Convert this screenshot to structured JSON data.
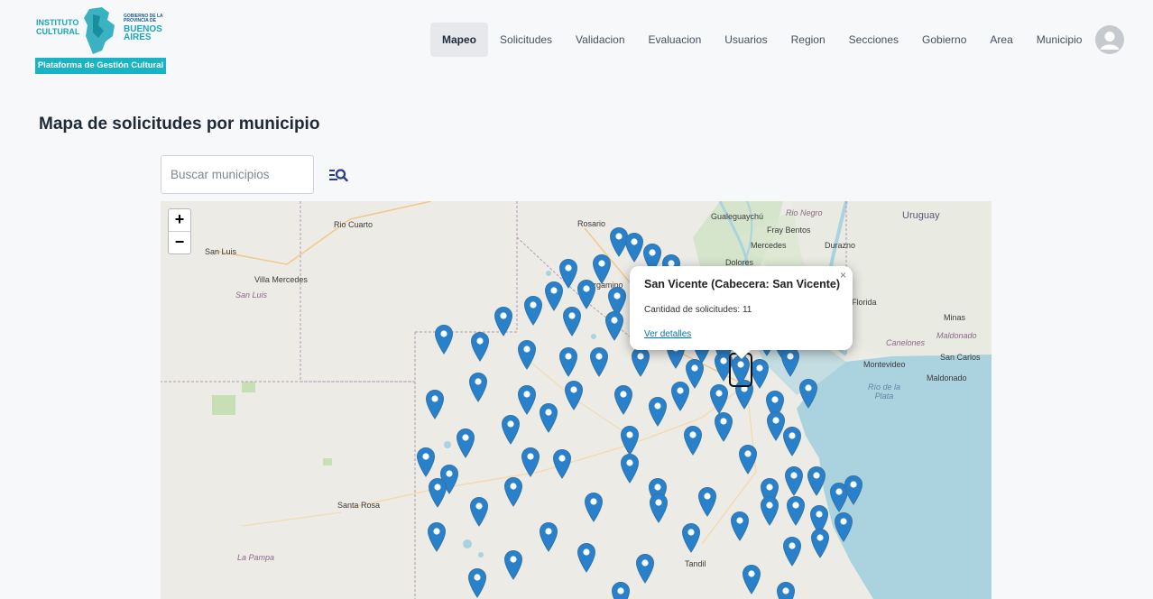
{
  "brand": {
    "ic_line1": "INSTITUTO",
    "ic_line2": "CULTURAL",
    "gob_text": "GOBIERNO DE LA PROVINCIA DE",
    "ba_line1": "BUENOS",
    "ba_line2": "AIRES",
    "platform": "Plataforma de Gestión Cultural"
  },
  "nav": [
    "Mapeo",
    "Solicitudes",
    "Validacion",
    "Evaluacion",
    "Usuarios",
    "Region",
    "Secciones",
    "Gobierno",
    "Area",
    "Municipio"
  ],
  "nav_active": "Mapeo",
  "page_title": "Mapa de solicitudes por municipio",
  "search": {
    "placeholder": "Buscar municipios",
    "value": ""
  },
  "map": {
    "zoom_in": "+",
    "zoom_out": "−",
    "labels": {
      "rio_cuarto": "Rio Cuarto",
      "rosario": "Rosario",
      "gualeguaychu": "Gualeguaychú",
      "rio_negro": "Rio Negro",
      "uruguay": "Uruguay",
      "fray_bentos": "Fray Bentos",
      "mercedes": "Mercedes",
      "durazno": "Durazno",
      "dolores": "Dolores",
      "san_luis_city": "San Luis",
      "villa_mercedes": "Villa Mercedes",
      "san_luis_prov": "San Luis",
      "pergamino": "Pergamino",
      "florida": "Florida",
      "canelones": "Canelones",
      "minas": "Minas",
      "maldonado_prov": "Maldonado",
      "montevideo": "Montevideo",
      "san_carlos": "San Carlos",
      "maldonado": "Maldonado",
      "rio_de_la_plata": "Río de la Plata",
      "santa_rosa": "Santa Rosa",
      "la_pampa": "La Pampa",
      "tandil": "Tandil"
    },
    "popup": {
      "title": "San Vicente (Cabecera: San Vicente)",
      "count": "Cantidad de solicitudes: 11",
      "link": "Ver detalles",
      "close": "×"
    },
    "colors": {
      "marker": "#2a81cb",
      "marker_dark": "#3274a3",
      "water": "#aad3df",
      "land": "#ecebe6"
    }
  }
}
